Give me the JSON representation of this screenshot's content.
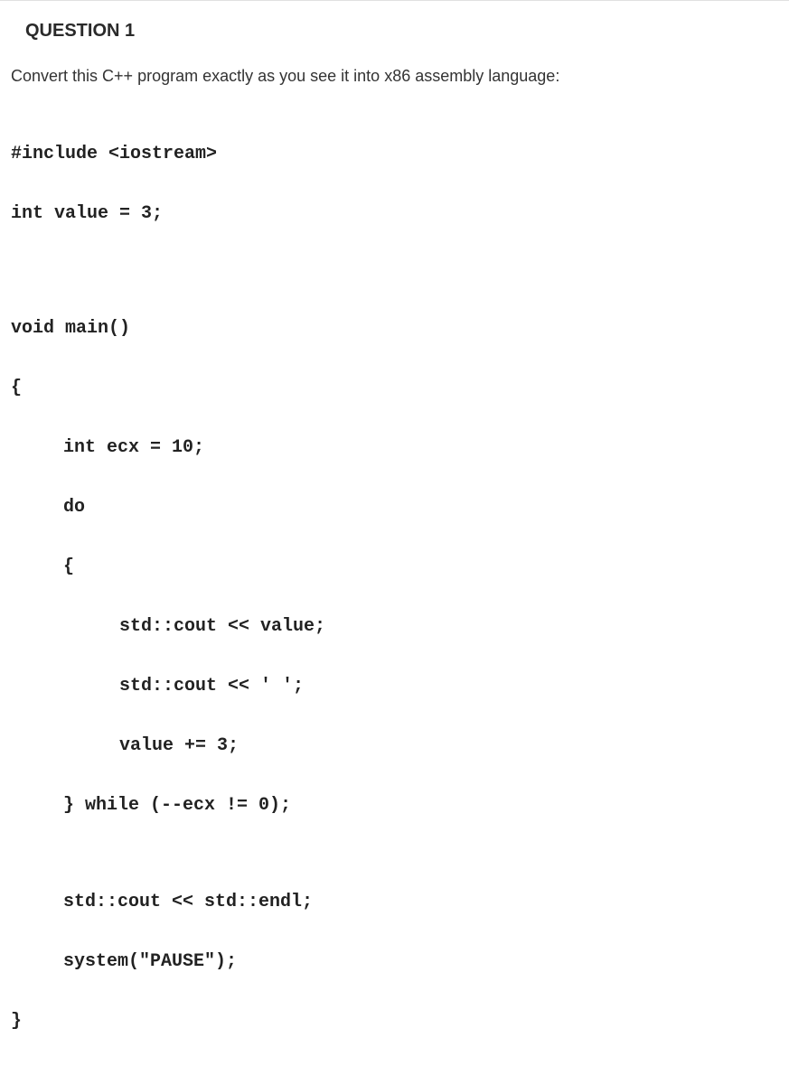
{
  "heading": "QUESTION 1",
  "instruction": "Convert this C++ program exactly as you see it into x86 assembly language:",
  "code": {
    "line1": "#include <iostream>",
    "line2": "int value = 3;",
    "line3": "void main()",
    "line4": "{",
    "line5": "int ecx = 10;",
    "line6": "do",
    "line7": "{",
    "line8": "std::cout << value;",
    "line9": "std::cout << ' ';",
    "line10": "value += 3;",
    "line11": "} while (--ecx != 0);",
    "line12": "std::cout << std::endl;",
    "line13": "system(\"PAUSE\");",
    "line14": "}"
  }
}
